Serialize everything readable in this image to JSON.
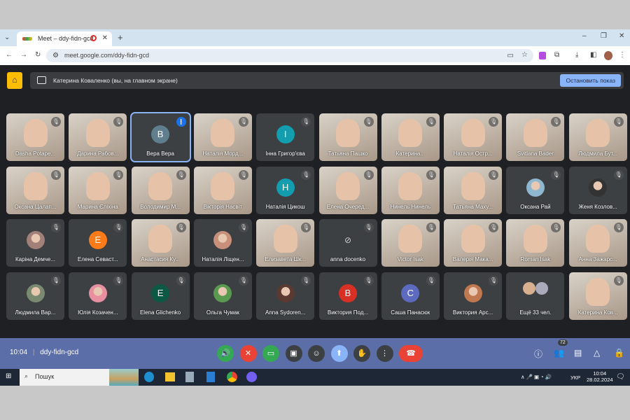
{
  "browser": {
    "tab_title": "Meet – ddy-fidn-gcd",
    "url": "meet.google.com/ddy-fidn-gcd",
    "new_tab": "+",
    "minimize": "–",
    "maximize": "❐",
    "close": "✕"
  },
  "banner": {
    "text": "Катерина Коваленко (вы, на главном экране)",
    "stop_label": "Остановить показ"
  },
  "tiles": [
    {
      "name": "Dasha Potape...",
      "kind": "video"
    },
    {
      "name": "Дарина Рабов...",
      "kind": "video"
    },
    {
      "name": "Вера Вера",
      "kind": "letter",
      "letter": "B",
      "color": "#5f7f8f",
      "speaking": true
    },
    {
      "name": "Наталія Морд...",
      "kind": "video"
    },
    {
      "name": "Інна Григор'єва",
      "kind": "letter",
      "letter": "I",
      "color": "#129eaf"
    },
    {
      "name": "Татьяна Пашко",
      "kind": "video"
    },
    {
      "name": "Катерина...",
      "kind": "video"
    },
    {
      "name": "Наталія Остр...",
      "kind": "video"
    },
    {
      "name": "Svitlana Bader",
      "kind": "video"
    },
    {
      "name": "Людмила Бут...",
      "kind": "video"
    },
    {
      "name": "Оксана Цалап...",
      "kind": "video"
    },
    {
      "name": "Марина Єліхіна",
      "kind": "video"
    },
    {
      "name": "Володимир М...",
      "kind": "video"
    },
    {
      "name": "Вікторія Насвіт",
      "kind": "video"
    },
    {
      "name": "Наталія Цикош",
      "kind": "letter",
      "letter": "H",
      "color": "#129eaf"
    },
    {
      "name": "Елена Очеред...",
      "kind": "video"
    },
    {
      "name": "Нинель Нинель",
      "kind": "video"
    },
    {
      "name": "Татьяна Маху...",
      "kind": "video"
    },
    {
      "name": "Оксана Рай",
      "kind": "photo",
      "color": "#8fb8d0"
    },
    {
      "name": "Женя Козлов...",
      "kind": "photo",
      "color": "#333"
    },
    {
      "name": "Каріна Демче...",
      "kind": "photo",
      "color": "#a08078"
    },
    {
      "name": "Елена Севаст...",
      "kind": "letter",
      "letter": "E",
      "color": "#fa7b17"
    },
    {
      "name": "Анастасия Ку...",
      "kind": "video"
    },
    {
      "name": "Наталія Ліщен...",
      "kind": "photo",
      "color": "#c8907a"
    },
    {
      "name": "Елизавета Шк...",
      "kind": "video"
    },
    {
      "name": "anna docenko",
      "kind": "camoff"
    },
    {
      "name": "Victor Isak",
      "kind": "video"
    },
    {
      "name": "Валерія Мака...",
      "kind": "video"
    },
    {
      "name": "Roman Isak",
      "kind": "video"
    },
    {
      "name": "Анна Зажарс...",
      "kind": "video"
    },
    {
      "name": "Людмила Вар...",
      "kind": "photo",
      "color": "#7a8a70"
    },
    {
      "name": "Юлія Козачен...",
      "kind": "photo",
      "color": "#e890a0"
    },
    {
      "name": "Elena Glichenko",
      "kind": "letter",
      "letter": "E",
      "color": "#0b5844"
    },
    {
      "name": "Ольга Чумак",
      "kind": "photo",
      "color": "#5a9a50"
    },
    {
      "name": "Anna Sydoren...",
      "kind": "photo",
      "color": "#5a3a30"
    },
    {
      "name": "Виктория Под...",
      "kind": "letter",
      "letter": "B",
      "color": "#d93025"
    },
    {
      "name": "Саша Панасюк",
      "kind": "letter",
      "letter": "C",
      "color": "#5c6bc0"
    },
    {
      "name": "Виктория Арс...",
      "kind": "photo",
      "color": "#c07850"
    },
    {
      "name": "Ещё 33 чел.",
      "kind": "more"
    },
    {
      "name": "Катерина Ков...",
      "kind": "video"
    }
  ],
  "controls": {
    "time": "10:04",
    "meeting_code": "ddy-fidn-gcd",
    "participants_count": "72",
    "buttons": [
      {
        "icon": "🔊",
        "color": "#34a853"
      },
      {
        "icon": "✕",
        "color": "#ea4335"
      },
      {
        "icon": "▭",
        "color": "#34a853"
      },
      {
        "icon": "▣",
        "color": "#3c4043"
      },
      {
        "icon": "☺",
        "color": "#3c4043"
      },
      {
        "icon": "⬆",
        "color": "#8ab4f8"
      },
      {
        "icon": "✋",
        "color": "#3c4043"
      },
      {
        "icon": "⋮",
        "color": "#3c4043"
      },
      {
        "icon": "☎",
        "color": "#ea4335"
      }
    ]
  },
  "taskbar": {
    "search_placeholder": "Пошук",
    "lang": "УКР",
    "time": "10:04",
    "date": "28.02.2024"
  }
}
